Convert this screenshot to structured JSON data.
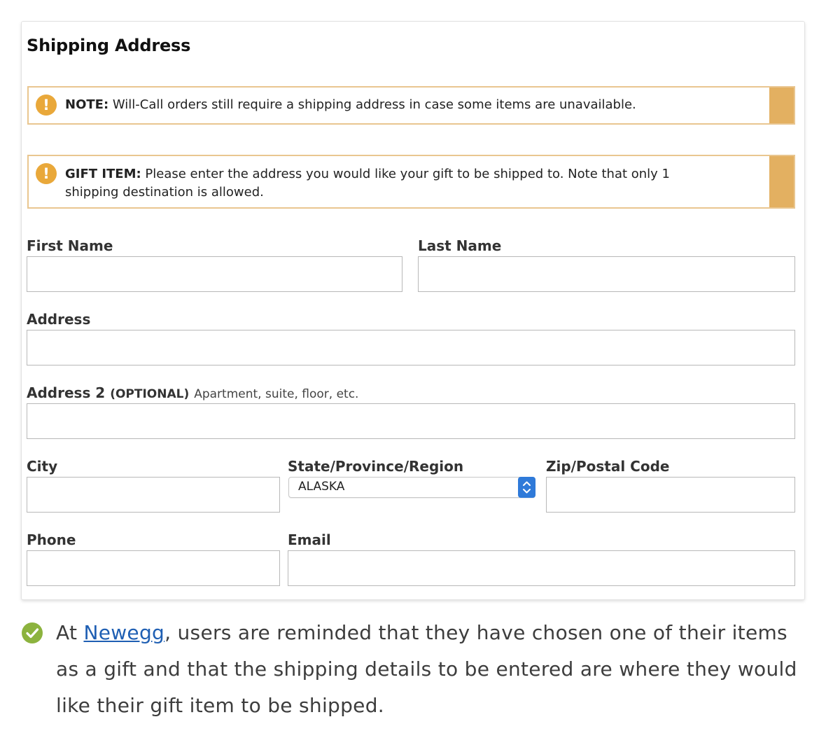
{
  "form": {
    "title": "Shipping Address",
    "note": {
      "label": "NOTE:",
      "text": " Will-Call orders still require a shipping address in case some items are unavailable."
    },
    "gift": {
      "label": "GIFT ITEM:",
      "text": " Please enter the address you would like your gift to be shipped to. Note that only 1 shipping destination is allowed."
    },
    "fields": {
      "first_name": {
        "label": "First Name",
        "value": ""
      },
      "last_name": {
        "label": "Last Name",
        "value": ""
      },
      "address": {
        "label": "Address",
        "value": ""
      },
      "address2": {
        "label": "Address 2",
        "optional": "(OPTIONAL)",
        "hint": "Apartment, suite, floor, etc.",
        "value": ""
      },
      "city": {
        "label": "City",
        "value": ""
      },
      "state": {
        "label": "State/Province/Region",
        "value": "ALASKA"
      },
      "zip": {
        "label": "Zip/Postal Code",
        "value": ""
      },
      "phone": {
        "label": "Phone",
        "value": ""
      },
      "email": {
        "label": "Email",
        "value": ""
      }
    },
    "icons": {
      "warning": "exclamation-circle-icon"
    },
    "colors": {
      "note_border": "#e9c690",
      "note_stripe": "#e3b061",
      "warning_icon": "#e9a83a",
      "select_accent": "#2f7ad9"
    }
  },
  "caption": {
    "prefix": "At ",
    "link_text": "Newegg",
    "rest": ", users are reminded that they have chosen one of their items as a gift and that the shipping details to be entered are where they would like their gift item to be shipped.",
    "icon": "check-circle-icon",
    "icon_color": "#8cb33e",
    "link_color": "#1f5fb3"
  }
}
